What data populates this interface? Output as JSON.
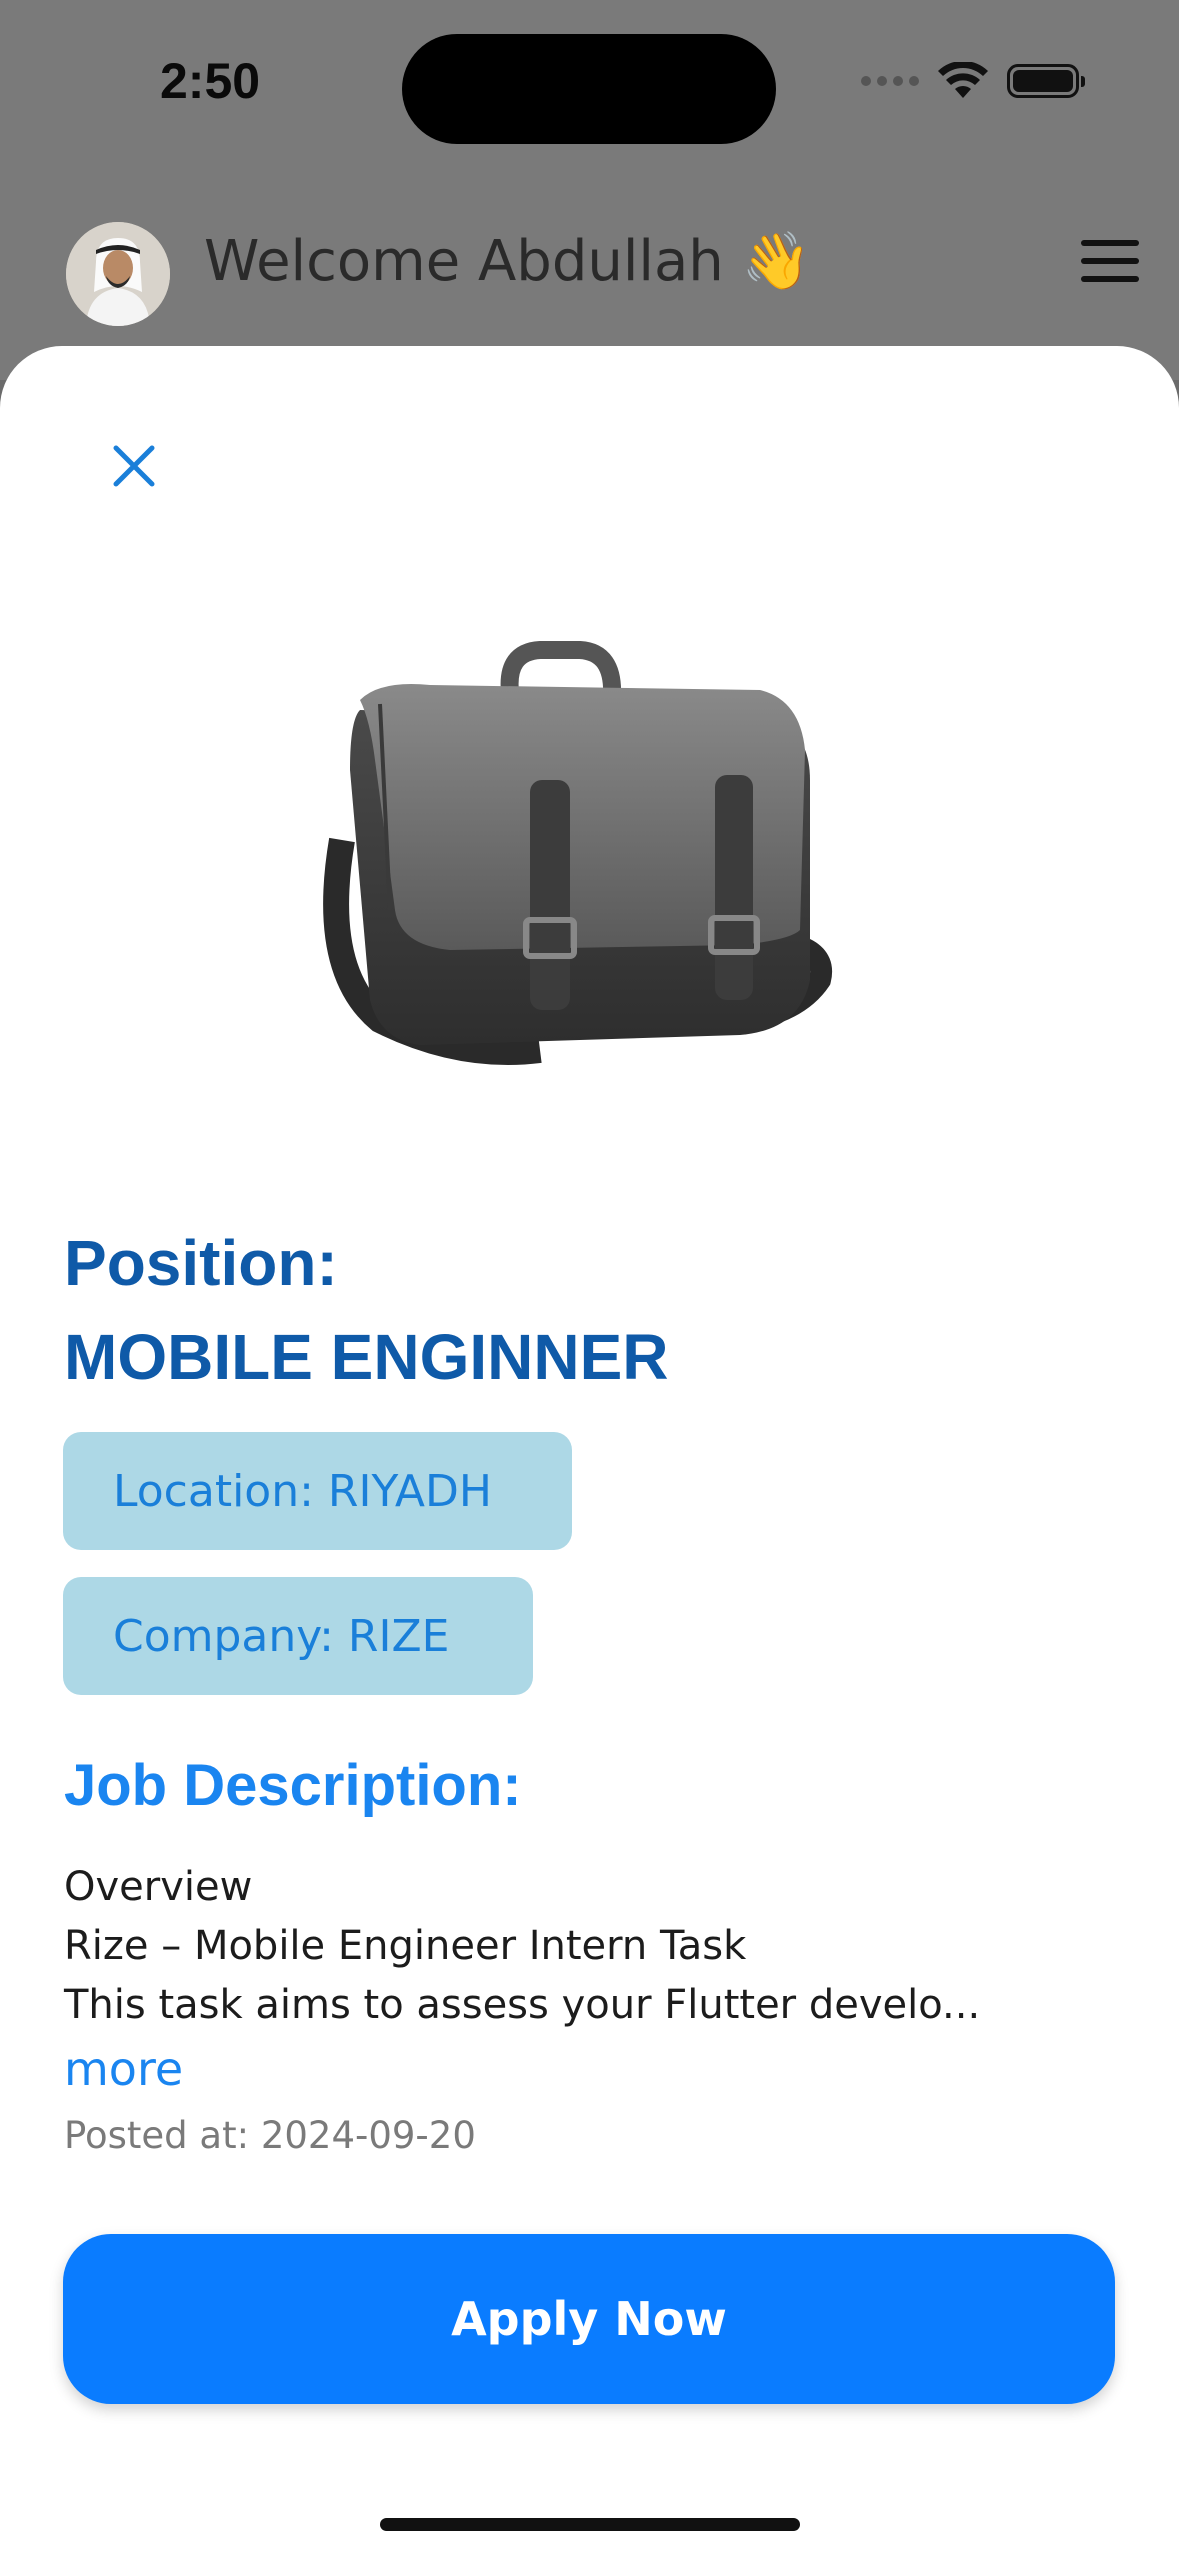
{
  "status_bar": {
    "time": "2:50"
  },
  "header": {
    "welcome_text": "Welcome Abdullah",
    "wave_emoji": "👋",
    "avatar_icon": "user-avatar",
    "menu_icon": "hamburger-menu-icon"
  },
  "sheet": {
    "close_icon": "close-icon",
    "image_icon": "briefcase-bag-image",
    "position_label": "Position:",
    "position_value": "MOBILE ENGINNER",
    "location": "Location: RIYADH",
    "company": "Company: RIZE",
    "description_heading": "Job Description:",
    "description_lines": [
      "Overview",
      "Rize – Mobile Engineer Intern Task",
      "This task aims to assess your Flutter develo..."
    ],
    "more_link": "more",
    "posted_at": "Posted at: 2024-09-20",
    "apply_button": "Apply Now"
  },
  "colors": {
    "primary": "#0a7cff",
    "heading_dark_blue": "#0f5aa8",
    "chip_bg": "#add8e6",
    "chip_text": "#1a7fd9"
  }
}
